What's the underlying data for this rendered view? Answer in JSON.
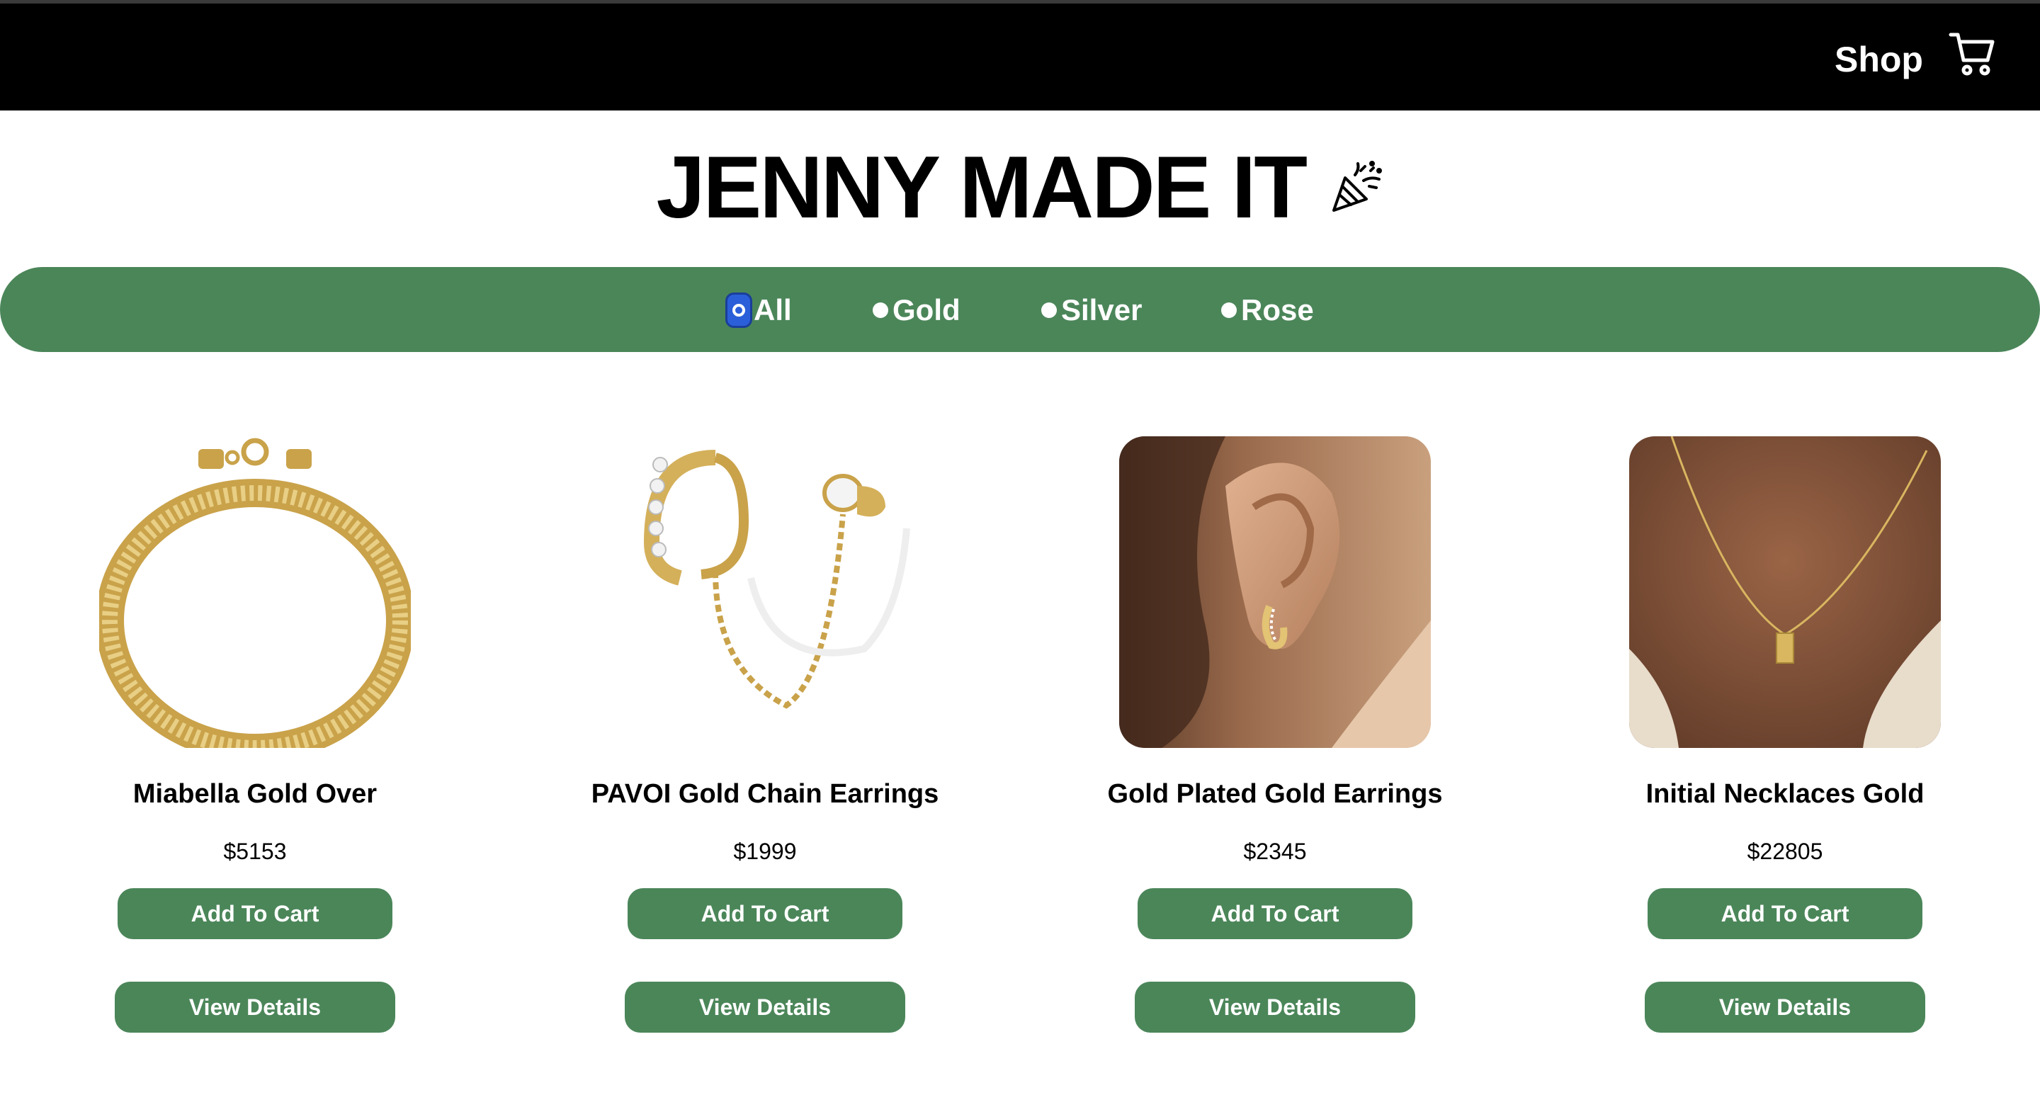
{
  "header": {
    "shop_label": "Shop",
    "cart_icon": "cart-icon"
  },
  "brand": {
    "title": "JENNY MADE IT",
    "icon": "party-popper-icon"
  },
  "filters": [
    {
      "label": "All",
      "selected": true
    },
    {
      "label": "Gold",
      "selected": false
    },
    {
      "label": "Silver",
      "selected": false
    },
    {
      "label": "Rose",
      "selected": false
    }
  ],
  "products": [
    {
      "name": "Miabella Gold Over",
      "price": "$5153",
      "add_label": "Add To Cart",
      "view_label": "View Details"
    },
    {
      "name": "PAVOI Gold Chain Earrings",
      "price": "$1999",
      "add_label": "Add To Cart",
      "view_label": "View Details"
    },
    {
      "name": "Gold Plated Gold Earrings",
      "price": "$2345",
      "add_label": "Add To Cart",
      "view_label": "View Details"
    },
    {
      "name": "Initial Necklaces Gold",
      "price": "$22805",
      "add_label": "Add To Cart",
      "view_label": "View Details"
    }
  ],
  "colors": {
    "accent": "#4b8659",
    "header_bg": "#000000",
    "gold": "#d8b65a",
    "skin": "#8a5a3c"
  }
}
